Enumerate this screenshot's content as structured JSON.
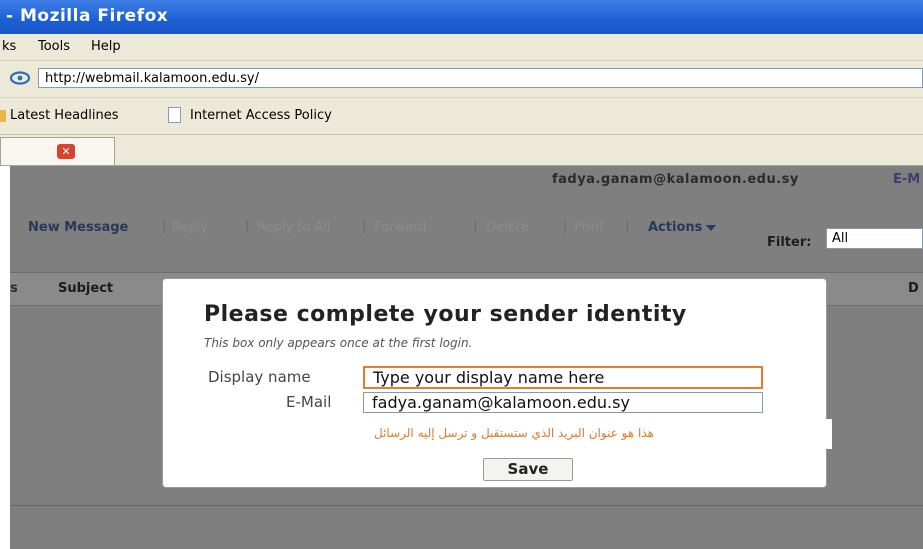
{
  "window": {
    "title": "- Mozilla Firefox"
  },
  "menubar": {
    "items": [
      "ks",
      "Tools",
      "Help"
    ]
  },
  "urlbar": {
    "url": "http://webmail.kalamoon.edu.sy/"
  },
  "bookmarks": {
    "items": [
      "Latest Headlines",
      "Internet Access Policy"
    ]
  },
  "webmail": {
    "user_email": "fadya.ganam@kalamoon.edu.sy",
    "user_menu": "E-M",
    "toolbar": {
      "new_message": "New Message",
      "reply": "Reply",
      "reply_all": "Reply to All",
      "forward": "Forward",
      "delete": "Delete",
      "print": "Print",
      "actions": "Actions",
      "separator": "|"
    },
    "filter": {
      "label": "Filter:",
      "value": "All"
    },
    "columns": {
      "mark": "s",
      "subject": "Subject",
      "date": "D"
    }
  },
  "dialog": {
    "title": "Please complete your sender identity",
    "subtitle": "This box only appears once at the first login.",
    "display_name_label": "Display name",
    "display_name_value": "Type your display name here",
    "email_label": "E-Mail",
    "email_value": "fadya.ganam@kalamoon.edu.sy",
    "note": "هذا هو عنوان البريد الذي ستستقبل و ترسل إليه الرسائل",
    "save_label": "Save"
  },
  "colors": {
    "titlebar": "#1b5fd6",
    "accent_border": "#e07f2c",
    "note_text": "#e07a2b"
  }
}
